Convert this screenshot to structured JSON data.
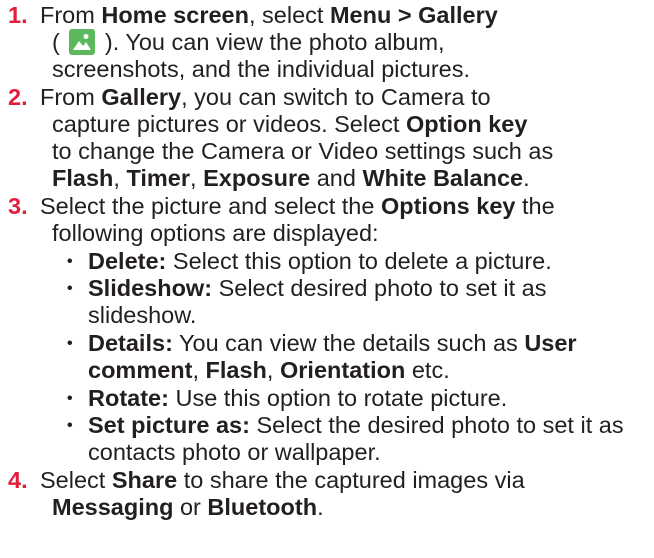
{
  "steps": [
    {
      "number": "1.",
      "line1": {
        "pre": "From ",
        "b1": "Home screen",
        "mid": ", select ",
        "b2": "Menu > Gallery"
      },
      "line2": {
        "open": "( ",
        "close": " ). You can view the photo album,"
      },
      "line3": "screenshots, and the individual pictures."
    },
    {
      "number": "2.",
      "line1": {
        "pre": "From ",
        "b1": "Gallery",
        "post": ", you can switch to Camera to"
      },
      "line2": {
        "pre": "capture pictures or videos. Select ",
        "b1": "Option key"
      },
      "line3": "to change the Camera or Video settings such as",
      "line4": {
        "b1": "Flash",
        "s1": ", ",
        "b2": "Timer",
        "s2": ", ",
        "b3": "Exposure",
        "s3": " and ",
        "b4": "White Balance",
        "end": "."
      }
    },
    {
      "number": "3.",
      "line1": {
        "pre": "Select the picture and select the ",
        "b1": "Options key",
        "post": " the"
      },
      "line2": "following options are displayed:",
      "bullet_char": "•",
      "bullets": [
        {
          "b1": "Delete:",
          "text": " Select this option to delete a picture."
        },
        {
          "b1": "Slideshow:",
          "text": " Select desired photo to set it as",
          "cont": "slideshow."
        },
        {
          "b1": "Details:",
          "text": " You can view the details such as ",
          "b2": "User",
          "cont_b1": "comment",
          "cont_s1": ", ",
          "cont_b2": "Flash",
          "cont_s2": ", ",
          "cont_b3": "Orientation",
          "cont_end": " etc."
        },
        {
          "b1": "Rotate:",
          "text": " Use this option to rotate picture."
        },
        {
          "b1": "Set picture as:",
          "text": " Select the desired photo to set it as",
          "cont": "contacts photo or wallpaper."
        }
      ]
    },
    {
      "number": "4.",
      "line1": {
        "pre": "Select ",
        "b1": "Share",
        "post": " to share the captured images via"
      },
      "line2": {
        "b1": "Messaging",
        "mid": " or ",
        "b2": "Bluetooth",
        "end": "."
      }
    }
  ],
  "icons": {
    "gallery": "gallery-app-icon",
    "gallery_color": "#5cb85c",
    "number_color": "#e31e3c"
  }
}
